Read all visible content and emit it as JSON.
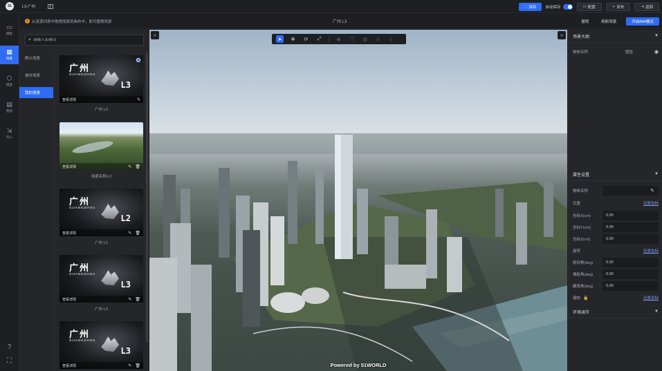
{
  "topbar": {
    "logo_text": "51",
    "project_name": "L3-广州",
    "save_label": "保存",
    "autosave_label": "自动保存",
    "publish_label": "发布",
    "back_label": "返回",
    "extra_label": "配置"
  },
  "subbar": {
    "notice": "从资源列表中拖拽场景到画布中，即可替换场景",
    "scene_title": "广州 L3",
    "undo_label": "撤销",
    "refresh_label": "刷新场景",
    "bim_label": "开启BIM模式"
  },
  "rail": {
    "items": [
      {
        "label": "模板",
        "glyph": "▭"
      },
      {
        "label": "场景",
        "glyph": "▦"
      },
      {
        "label": "模型",
        "glyph": "⬡"
      },
      {
        "label": "图层",
        "glyph": "▤"
      },
      {
        "label": "导入",
        "glyph": "⇲"
      }
    ],
    "help_icon": "?",
    "fullscreen_icon": "⛶"
  },
  "panel": {
    "search_placeholder": "请输入关键词",
    "categories": [
      "默认场景",
      "城市场景",
      "我的场景"
    ],
    "cards": [
      {
        "title": "广州 L3",
        "tag": "L3",
        "view_label": "查看详情",
        "type": "gz"
      },
      {
        "title": "场景名称0.2",
        "tag": "",
        "view_label": "查看详情",
        "type": "nature"
      },
      {
        "title": "广州 L2",
        "tag": "L2",
        "view_label": "查看详情",
        "type": "gz"
      },
      {
        "title": "广州 L3",
        "tag": "L3",
        "view_label": "查看详情",
        "type": "gz"
      },
      {
        "title": "",
        "tag": "L3",
        "view_label": "查看详情",
        "type": "gz"
      }
    ],
    "gz_cn": "广州",
    "gz_en": "GUANGZHOU"
  },
  "viewport": {
    "powered": "Powered by 51WORLD"
  },
  "right": {
    "outline_title": "场景大纲",
    "outline_name_label": "物体名称",
    "outline_layer": "图层",
    "props_title": "属性设置",
    "name_label": "物体名称",
    "position_label": "位置",
    "reset_label": "还原坐标",
    "x_label": "坐标X(cm)",
    "y_label": "坐标Y(cm)",
    "z_label": "坐标Z(cm)",
    "rotation_label": "旋转",
    "pitch_label": "俯仰角(deg)",
    "yaw_label": "偏航角(deg)",
    "roll_label": "翻滚角(deg)",
    "scale_label": "缩放",
    "x_val": "0.00",
    "y_val": "0.00",
    "z_val": "0.00",
    "pitch_val": "0.00",
    "yaw_val": "0.00",
    "roll_val": "0.00",
    "env_title": "环境调节"
  }
}
